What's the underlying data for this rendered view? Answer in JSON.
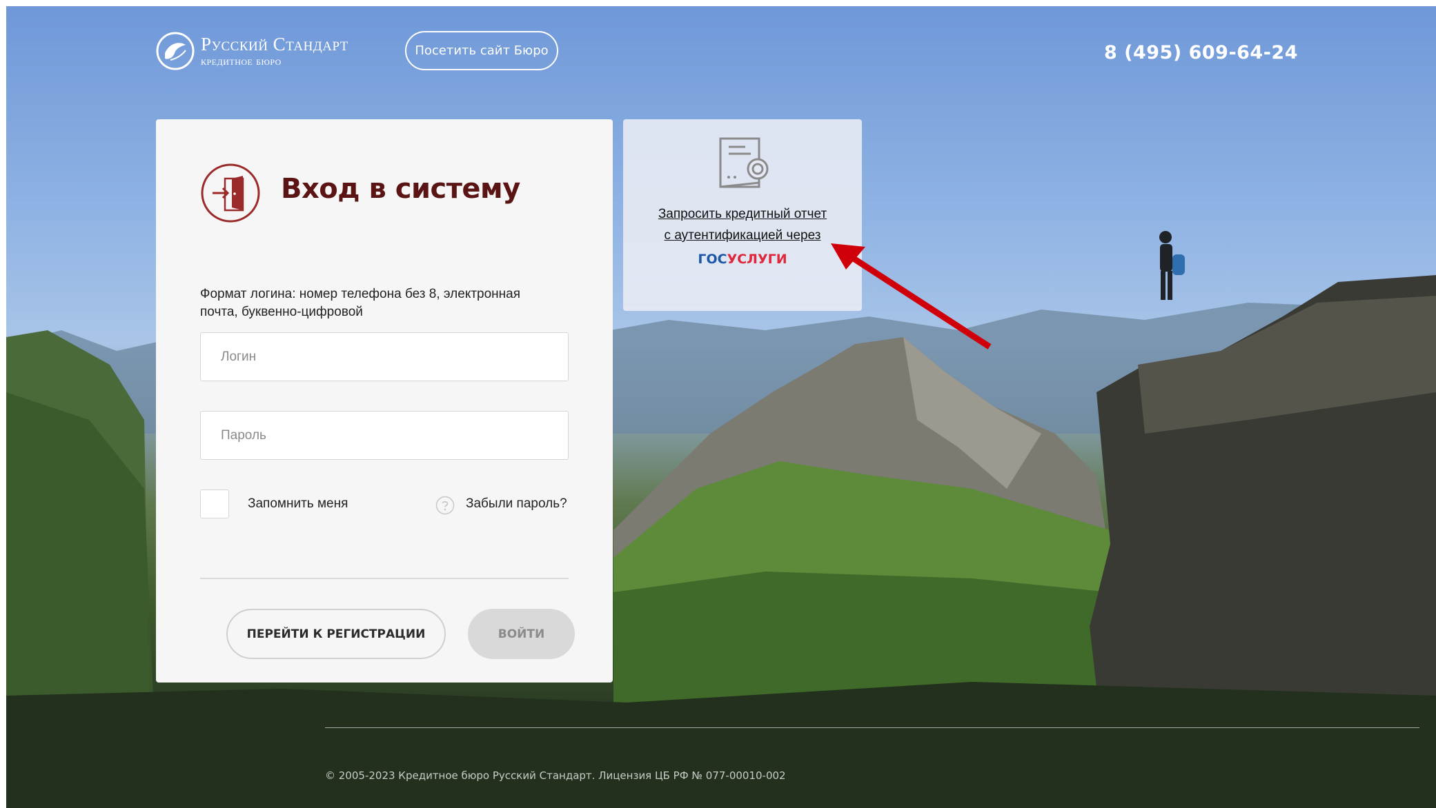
{
  "header": {
    "logo_title": "Русский Стандарт",
    "logo_subtitle": "кредитное бюро",
    "visit_button": "Посетить сайт Бюро",
    "phone": "8 (495) 609-64-24"
  },
  "login": {
    "title": "Вход в систему",
    "hint": "Формат логина: номер телефона без 8, электронная почта, буквенно-цифровой",
    "login_placeholder": "Логин",
    "password_placeholder": "Пароль",
    "remember_label": "Запомнить меня",
    "forgot_label": "Забыли пароль?",
    "register_button": "ПЕРЕЙТИ К РЕГИСТРАЦИИ",
    "enter_button": "ВОЙТИ"
  },
  "gosuslugi": {
    "link_line1": "Запросить кредитный отчет",
    "link_line2": "с аутентификацией через",
    "brand_part1": "ГОС",
    "brand_part2": "УСЛУГИ"
  },
  "footer": {
    "copyright": "© 2005-2023 Кредитное бюро Русский Стандарт. Лицензия ЦБ РФ № 077-00010-002"
  },
  "colors": {
    "title": "#5b1414",
    "accent": "#9b2b2b",
    "gos_blue": "#1e56a8",
    "gos_red": "#e0283c",
    "arrow": "#d0000a"
  }
}
